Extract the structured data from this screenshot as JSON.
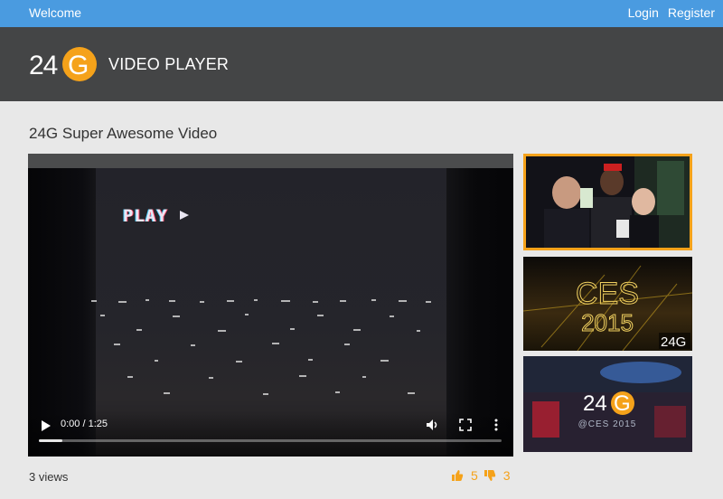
{
  "topbar": {
    "welcome": "Welcome",
    "login": "Login",
    "register": "Register"
  },
  "header": {
    "logo_text": "24G",
    "title": "VIDEO PLAYER"
  },
  "video": {
    "title": "24G Super Awesome Video",
    "overlay_text": "PLAY",
    "time_display": "0:00 / 1:25",
    "progress_fraction": 0.0,
    "buffered_fraction": 0.05
  },
  "related": [
    {
      "name": "crowd-photo"
    },
    {
      "name": "ces-2015",
      "line1": "CES",
      "line2": "2015",
      "badge": "24G"
    },
    {
      "name": "24g-ces",
      "logo": "24G",
      "caption": "@CES 2015"
    }
  ],
  "stats": {
    "views": "3 views",
    "likes": "5",
    "dislikes": "3"
  },
  "colors": {
    "accent": "#f5a21a",
    "topbar": "#4a9be0",
    "header": "#444546",
    "background": "#e8e8e8"
  },
  "icons": [
    "play-icon",
    "volume-icon",
    "fullscreen-icon",
    "more-options-icon",
    "thumbs-up-icon",
    "thumbs-down-icon"
  ]
}
